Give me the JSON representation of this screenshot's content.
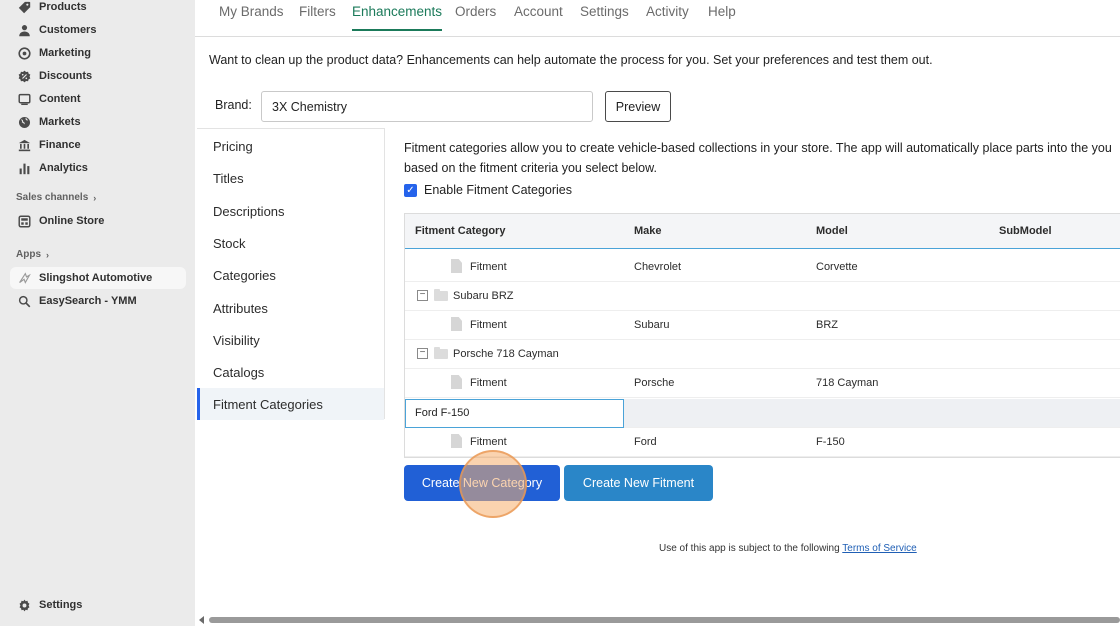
{
  "sidebar": {
    "items": [
      {
        "label": "Products",
        "icon": "tag-icon"
      },
      {
        "label": "Customers",
        "icon": "person-icon"
      },
      {
        "label": "Marketing",
        "icon": "target-icon"
      },
      {
        "label": "Discounts",
        "icon": "discount-icon"
      },
      {
        "label": "Content",
        "icon": "content-icon"
      },
      {
        "label": "Markets",
        "icon": "globe-icon"
      },
      {
        "label": "Finance",
        "icon": "bank-icon"
      },
      {
        "label": "Analytics",
        "icon": "bar-chart-icon"
      }
    ],
    "sales_channels_label": "Sales channels",
    "online_store": "Online Store",
    "apps_label": "Apps",
    "apps": [
      {
        "label": "Slingshot Automotive",
        "icon": "app-wing-icon",
        "active": true
      },
      {
        "label": "EasySearch - YMM",
        "icon": "search-icon",
        "active": false
      }
    ],
    "settings": "Settings"
  },
  "tabs": {
    "items": [
      "My Brands",
      "Filters",
      "Enhancements",
      "Orders",
      "Account",
      "Settings",
      "Activity",
      "Help"
    ],
    "active": "Enhancements"
  },
  "intro_text": "Want to clean up the product data? Enhancements can help automate the process for you. Set your preferences and test them out.",
  "brand": {
    "label": "Brand:",
    "value": "3X Chemistry",
    "preview_label": "Preview"
  },
  "menu": {
    "items": [
      "Pricing",
      "Titles",
      "Descriptions",
      "Stock",
      "Categories",
      "Attributes",
      "Visibility",
      "Catalogs",
      "Fitment Categories"
    ],
    "active": "Fitment Categories"
  },
  "fitment": {
    "description": "Fitment categories allow you to create vehicle-based collections in your store. The app will automatically place parts into the you based on the fitment criteria you select below.",
    "enable_label": "Enable Fitment Categories",
    "enabled": true,
    "columns": [
      "Fitment Category",
      "Make",
      "Model",
      "SubModel"
    ],
    "rows": [
      {
        "kind": "fitment",
        "label": "Fitment",
        "make": "Chevrolet",
        "model": "Corvette"
      },
      {
        "kind": "category",
        "label": "Subaru BRZ"
      },
      {
        "kind": "fitment",
        "label": "Fitment",
        "make": "Subaru",
        "model": "BRZ"
      },
      {
        "kind": "category",
        "label": "Porsche 718 Cayman"
      },
      {
        "kind": "fitment",
        "label": "Fitment",
        "make": "Porsche",
        "model": "718 Cayman"
      },
      {
        "kind": "editing",
        "label": "Ford F-150"
      },
      {
        "kind": "fitment",
        "label": "Fitment",
        "make": "Ford",
        "model": "F-150"
      }
    ],
    "create_category_label": "Create New Category",
    "create_fitment_label": "Create New Fitment"
  },
  "footer": {
    "tos_prefix": "Use of this app is subject to the following",
    "tos_link": "Terms of Service"
  },
  "colors": {
    "active_tab": "#1b7a5a",
    "primary_button": "#2160d6",
    "secondary_button": "#2a86c8",
    "sidebar_bg": "#ebebeb"
  }
}
